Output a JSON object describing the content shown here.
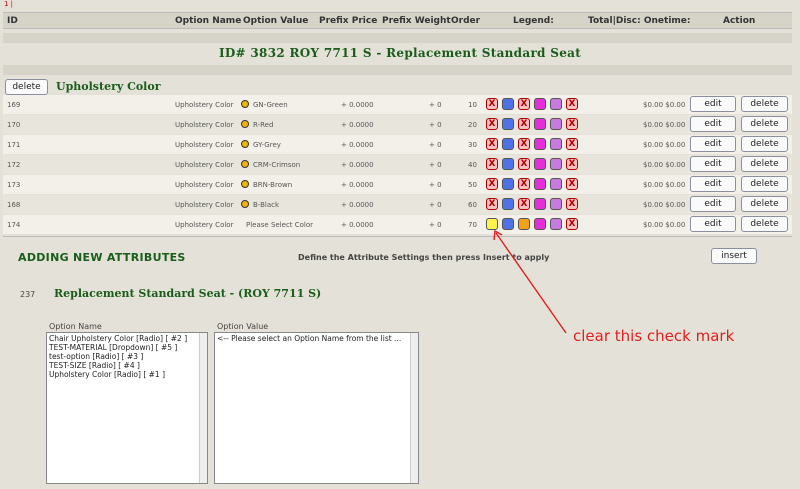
{
  "page_number": "1 |",
  "header": {
    "id": "ID",
    "option_name": "Option Name",
    "option_value": "Option Value",
    "prefix_price": "Prefix Price",
    "prefix_weight": "Prefix Weight",
    "order": "Order",
    "legend": "Legend:",
    "total": "Total|Disc: Onetime:",
    "action": "Action"
  },
  "title": "ID# 3832 ROY 7711 S - Replacement Standard Seat",
  "section": {
    "delete_label": "delete",
    "name": "Upholstery Color"
  },
  "rows": [
    {
      "id": "169",
      "name": "Upholstery Color",
      "value": "GN-Green",
      "price": "+ 0.0000",
      "weight": "+ 0",
      "order": "10",
      "total": "$0.00 $0.00",
      "default": false
    },
    {
      "id": "170",
      "name": "Upholstery Color",
      "value": "R-Red",
      "price": "+ 0.0000",
      "weight": "+ 0",
      "order": "20",
      "total": "$0.00 $0.00",
      "default": false
    },
    {
      "id": "171",
      "name": "Upholstery Color",
      "value": "GY-Grey",
      "price": "+ 0.0000",
      "weight": "+ 0",
      "order": "30",
      "total": "$0.00 $0.00",
      "default": false
    },
    {
      "id": "172",
      "name": "Upholstery Color",
      "value": "CRM-Crimson",
      "price": "+ 0.0000",
      "weight": "+ 0",
      "order": "40",
      "total": "$0.00 $0.00",
      "default": false
    },
    {
      "id": "173",
      "name": "Upholstery Color",
      "value": "BRN-Brown",
      "price": "+ 0.0000",
      "weight": "+ 0",
      "order": "50",
      "total": "$0.00 $0.00",
      "default": false
    },
    {
      "id": "168",
      "name": "Upholstery Color",
      "value": "B-Black",
      "price": "+ 0.0000",
      "weight": "+ 0",
      "order": "60",
      "total": "$0.00 $0.00",
      "default": false
    },
    {
      "id": "174",
      "name": "Upholstery Color",
      "value": "Please Select Color",
      "price": "+ 0.0000",
      "weight": "+ 0",
      "order": "70",
      "total": "$0.00 $0.00",
      "default": true
    }
  ],
  "row_buttons": {
    "edit": "edit",
    "delete": "delete"
  },
  "legend_icons": {
    "x_mark": "X",
    "colors": {
      "blue": "#4f73e6",
      "pink": "#e42fd8",
      "violet": "#c77ae0",
      "yellow": "#fff34a",
      "orange": "#f59f1b",
      "x_bg": "#f4c0c0"
    }
  },
  "adding": {
    "heading": "ADDING NEW ATTRIBUTES",
    "instructions": "Define the Attribute Settings then press Insert to apply",
    "insert_label": "insert",
    "product_id": "237",
    "product_name": "Replacement Standard Seat - (ROY 7711 S)",
    "option_name_label": "Option Name",
    "option_value_label": "Option Value",
    "option_names": [
      "Chair Upholstery Color  [Radio]  [ #2 ]",
      "TEST-MATERIAL  [Dropdown]  [ #5 ]",
      "test-option  [Radio]  [ #3 ]",
      "TEST-SIZE  [Radio]  [ #4 ]",
      "Upholstery Color  [Radio]  [ #1 ]"
    ],
    "option_values": [
      "<-- Please select an Option Name from the list ..."
    ]
  },
  "annotation": "clear this check mark",
  "accent_color": "#1a5c1a",
  "annotation_color": "#e02020"
}
